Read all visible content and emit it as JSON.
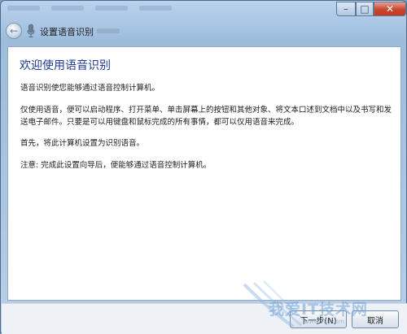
{
  "window": {
    "title": "设置语音识别",
    "close_symbol": "✕",
    "min_symbol": "–",
    "max_symbol": "□"
  },
  "nav": {
    "back_symbol": "←"
  },
  "content": {
    "heading": "欢迎使用语音识别",
    "paragraphs": [
      "语音识别使您能够通过语音控制计算机。",
      "仅使用语音，便可以启动程序、打开菜单、单击屏幕上的按钮和其他对象、将文本口述到文档中以及书写和发送电子邮件。只要是可以用键盘和鼠标完成的所有事情，都可以仅用语音来完成。",
      "首先，将此计算机设置为识别语音。",
      "注意: 完成此设置向导后，便能够通过语音控制计算机。"
    ]
  },
  "footer": {
    "next_label": "下一步(N)",
    "cancel_label": "取消"
  },
  "watermark": {
    "text": "我爱IT技术网",
    "url": "www.52ij.com"
  },
  "colors": {
    "heading": "#1f3a93",
    "close": "#c73a22"
  },
  "icons": [
    "back-arrow-icon",
    "microphone-icon",
    "close-icon",
    "minimize-icon",
    "maximize-icon"
  ]
}
